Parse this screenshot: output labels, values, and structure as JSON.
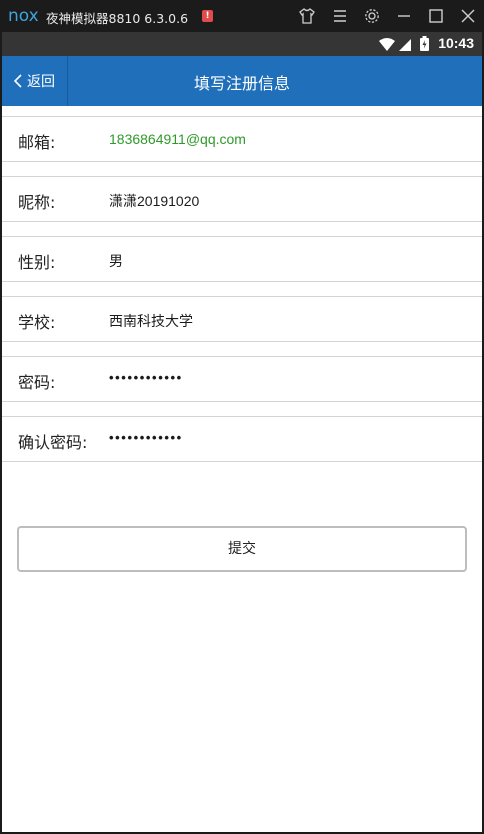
{
  "emulator": {
    "logo": "nox",
    "title": "夜神模拟器8810 6.3.0.6",
    "warning_badge": "!",
    "icons": [
      "shirt-icon",
      "menu-icon",
      "gear-icon",
      "minimize-icon",
      "maximize-icon",
      "close-icon"
    ]
  },
  "status_bar": {
    "time": "10:43",
    "icons": [
      "wifi-icon",
      "signal-icon",
      "battery-icon"
    ]
  },
  "header": {
    "back_label": "返回",
    "title": "填写注册信息"
  },
  "form": {
    "fields": [
      {
        "label": "邮箱:",
        "value": "1836864911@qq.com",
        "type": "email"
      },
      {
        "label": "昵称:",
        "value": "潇潇20191020",
        "type": "text"
      },
      {
        "label": "性别:",
        "value": "男",
        "type": "text"
      },
      {
        "label": "学校:",
        "value": "西南科技大学",
        "type": "text"
      },
      {
        "label": "密码:",
        "value": "••••••••••••",
        "type": "password"
      },
      {
        "label": "确认密码:",
        "value": "••••••••••••",
        "type": "password"
      }
    ],
    "submit_label": "提交"
  },
  "colors": {
    "header_bg": "#1f6fba",
    "email_text": "#2f9a2a",
    "emulator_bg": "#1b1b1b",
    "status_bar_bg": "#353535"
  }
}
